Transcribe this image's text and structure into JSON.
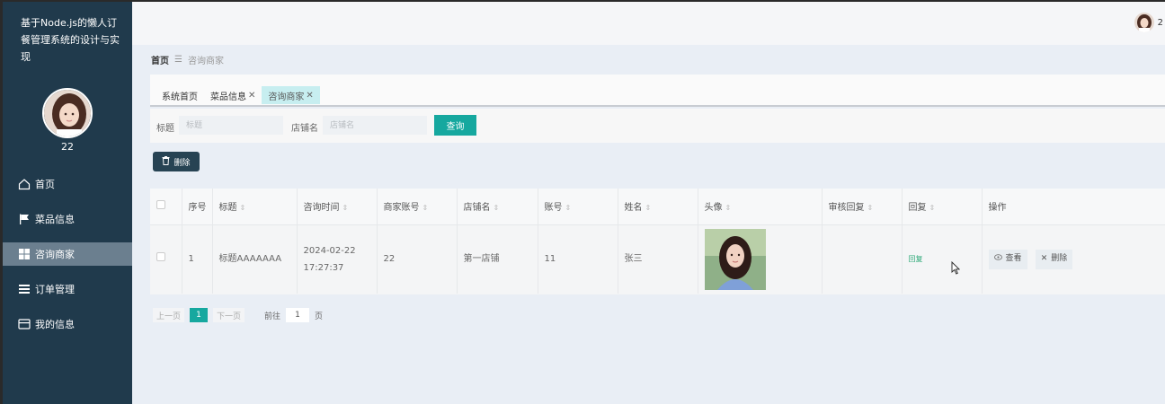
{
  "app": {
    "title": "基于Node.js的懒人订餐管理系统的设计与实现"
  },
  "user": {
    "name": "22",
    "header_name": "2"
  },
  "sidebar": {
    "items": [
      {
        "label": "首页",
        "icon": "home-icon"
      },
      {
        "label": "菜品信息",
        "icon": "flag-icon"
      },
      {
        "label": "咨询商家",
        "icon": "grid-icon"
      },
      {
        "label": "订单管理",
        "icon": "list-icon"
      },
      {
        "label": "我的信息",
        "icon": "card-icon"
      }
    ]
  },
  "breadcrumb": {
    "home": "首页",
    "separator": "☰",
    "current": "咨询商家"
  },
  "tabs": [
    {
      "label": "系统首页",
      "closable": false
    },
    {
      "label": "菜品信息",
      "closable": true
    },
    {
      "label": "咨询商家",
      "closable": true
    }
  ],
  "search": {
    "title_label": "标题",
    "title_placeholder": "标题",
    "shop_label": "店铺名",
    "shop_placeholder": "店铺名",
    "button": "查询"
  },
  "actions": {
    "delete": "删除"
  },
  "table": {
    "columns": [
      "序号",
      "标题",
      "咨询时间",
      "商家账号",
      "店铺名",
      "账号",
      "姓名",
      "头像",
      "审核回复",
      "回复",
      "操作"
    ],
    "rows": [
      {
        "index": "1",
        "title": "标题AAAAAAA",
        "time": "2024-02-22 17:27:37",
        "merchant": "22",
        "shop": "第一店铺",
        "account": "11",
        "name": "张三",
        "review": "",
        "reply": "回复",
        "view": "查看",
        "delete": "删除"
      }
    ]
  },
  "pagination": {
    "prev": "上一页",
    "current": "1",
    "next": "下一页",
    "goto": "前往",
    "page_input": "1",
    "unit": "页"
  },
  "colors": {
    "sidebar": "#203a4c",
    "accent": "#16a89f",
    "active_menu": "#6b7f8f",
    "reply": "#2aa876"
  }
}
